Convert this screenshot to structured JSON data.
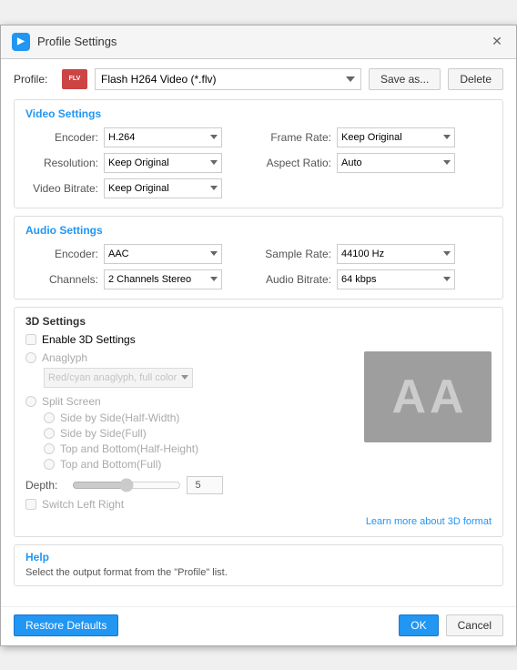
{
  "window": {
    "title": "Profile Settings",
    "close_label": "✕"
  },
  "profile": {
    "label": "Profile:",
    "icon_text": "FLV",
    "value": "Flash H264 Video (*.flv)",
    "save_as_label": "Save as...",
    "delete_label": "Delete"
  },
  "video_settings": {
    "title": "Video Settings",
    "encoder_label": "Encoder:",
    "encoder_value": "H.264",
    "resolution_label": "Resolution:",
    "resolution_value": "Keep Original",
    "video_bitrate_label": "Video Bitrate:",
    "video_bitrate_value": "Keep Original",
    "frame_rate_label": "Frame Rate:",
    "frame_rate_value": "Keep Original",
    "aspect_ratio_label": "Aspect Ratio:",
    "aspect_ratio_value": "Auto"
  },
  "audio_settings": {
    "title": "Audio Settings",
    "encoder_label": "Encoder:",
    "encoder_value": "AAC",
    "channels_label": "Channels:",
    "channels_value": "2 Channels Stereo",
    "sample_rate_label": "Sample Rate:",
    "sample_rate_value": "44100 Hz",
    "audio_bitrate_label": "Audio Bitrate:",
    "audio_bitrate_value": "64 kbps"
  },
  "settings_3d": {
    "title": "3D Settings",
    "enable_label": "Enable 3D Settings",
    "anaglyph_label": "Anaglyph",
    "anaglyph_type_value": "Red/cyan anaglyph, full color",
    "split_screen_label": "Split Screen",
    "split_options": [
      "Side by Side(Half-Width)",
      "Side by Side(Full)",
      "Top and Bottom(Half-Height)",
      "Top and Bottom(Full)"
    ],
    "depth_label": "Depth:",
    "depth_value": "5",
    "switch_label": "Switch Left Right",
    "learn_more_label": "Learn more about 3D format",
    "preview_letters": [
      "A",
      "A"
    ]
  },
  "help": {
    "title": "Help",
    "text": "Select the output format from the \"Profile\" list."
  },
  "footer": {
    "restore_label": "Restore Defaults",
    "ok_label": "OK",
    "cancel_label": "Cancel"
  }
}
